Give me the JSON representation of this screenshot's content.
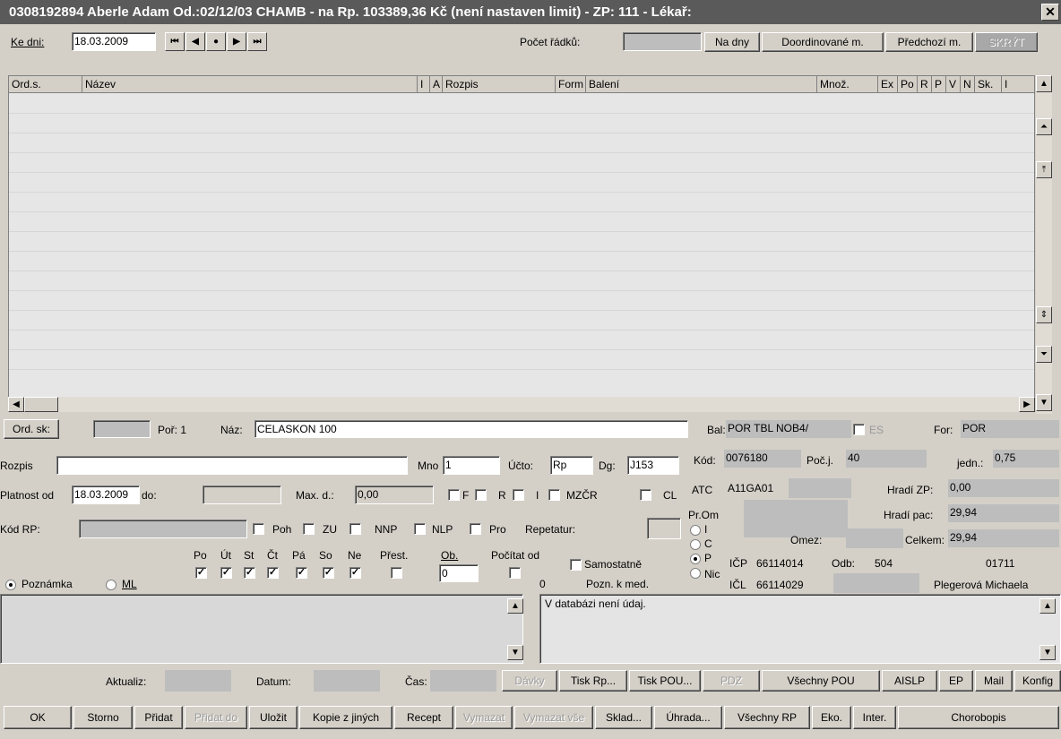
{
  "window": {
    "title": "0308192894 Aberle Adam  Od.:02/12/03  CHAMB - na Rp. 103389,36 Kč (není nastaven limit) - ZP: 111 - Lékař:",
    "close": "✕"
  },
  "toolbar": {
    "ke_dni_label": "Ke dni:",
    "date": "18.03.2009",
    "pocet_radku_label": "Počet řádků:",
    "pocet_radku_value": "",
    "na_dny": "Na dny",
    "doordinovane": "Doordinované m.",
    "predchozi": "Předchozí m.",
    "skryte": "SKRÝT"
  },
  "grid": {
    "columns": [
      "Ord.s.",
      "Název",
      "I",
      "A",
      "Rozpis",
      "Form",
      "Balení",
      "Množ.",
      "Ex",
      "Po",
      "R",
      "P",
      "V",
      "N",
      "Sk.",
      "I"
    ],
    "rows": []
  },
  "form": {
    "ord_sk_label": "Ord. sk:",
    "ord_sk_value": "",
    "por_label": "Poř: 1",
    "naz_label": "Náz:",
    "naz_value": "CELASKON 100",
    "rozpis_label": "Rozpis",
    "rozpis_value": "",
    "mno_label": "Mno",
    "mno_value": "1",
    "ucto_label": "Účto:",
    "ucto_value": "Rp",
    "dg_label": "Dg:",
    "dg_value": "J153",
    "platnost_label": "Platnost od",
    "platnost_value": "18.03.2009",
    "do_label": "do:",
    "do_value": "",
    "maxd_label": "Max. d.:",
    "maxd_value": "0,00",
    "flag_f": "F",
    "flag_r": "R",
    "flag_i": "I",
    "flag_mzcr": "MZČR",
    "flag_cl": "CL",
    "kodrp_label": "Kód RP:",
    "kodrp_value": "",
    "poh": "Poh",
    "zu": "ZU",
    "nnp": "NNP",
    "nlp": "NLP",
    "pro": "Pro",
    "repetatur_label": "Repetatur:",
    "days": [
      "Po",
      "Út",
      "St",
      "Čt",
      "Pá",
      "So",
      "Ne"
    ],
    "prest_label": "Přest.",
    "ob_label": "Ob.",
    "ob_value": "0",
    "pocitat_label": "Počítat od",
    "pocitat_value": "0",
    "samostatne_label": "Samostatně",
    "pozn_med_label": "Pozn. k med.",
    "poznamka_label": "Poznámka",
    "ml_label": "ML"
  },
  "info": {
    "bal_label": "Bal:",
    "bal_value": "POR TBL NOB4/",
    "es_label": "ES",
    "for_label": "For:",
    "for_value": "POR",
    "kod_label": "Kód:",
    "kod_value": "0076180",
    "poc_label": "Poč.j.",
    "poc_value": "40",
    "jedn_label": "jedn.:",
    "jedn_value": "0,75",
    "atc_label": "ATC",
    "atc_value": "A11GA01",
    "hradi_zp_label": "Hradí ZP:",
    "hradi_zp_value": "0,00",
    "hradi_pac_label": "Hradí pac:",
    "hradi_pac_value": "29,94",
    "celkem_label": "Celkem:",
    "celkem_value": "29,94",
    "prom_label": "Pr.Om",
    "omez_label": "Omez:",
    "radio_i": "I",
    "radio_c": "C",
    "radio_p": "P",
    "radio_nic": "Nic",
    "icp_label": "IČP",
    "icp_value": "66114014",
    "odb_label": "Odb:",
    "odb_value": "504",
    "odb_code": "01711",
    "icl_label": "IČL",
    "icl_value": "66114029",
    "doctor": "Plegerová Michaela"
  },
  "memo_right": "V databázi není údaj.",
  "status": {
    "aktualiz_label": "Aktualiz:",
    "datum_label": "Datum:",
    "cas_label": "Čas:"
  },
  "row1_buttons": [
    "Dávky",
    "Tisk Rp...",
    "Tisk POU...",
    "PDZ",
    "Všechny POU",
    "AISLP",
    "EP",
    "Mail",
    "Konfig"
  ],
  "row2_buttons": [
    "OK",
    "Storno",
    "Přidat",
    "Přidat do",
    "Uložit",
    "Kopie z jiných",
    "Recept",
    "Vymazat",
    "Vymazat vše",
    "Sklad...",
    "Úhrada...",
    "Všechny RP",
    "Eko.",
    "Inter.",
    "Chorobopis"
  ]
}
